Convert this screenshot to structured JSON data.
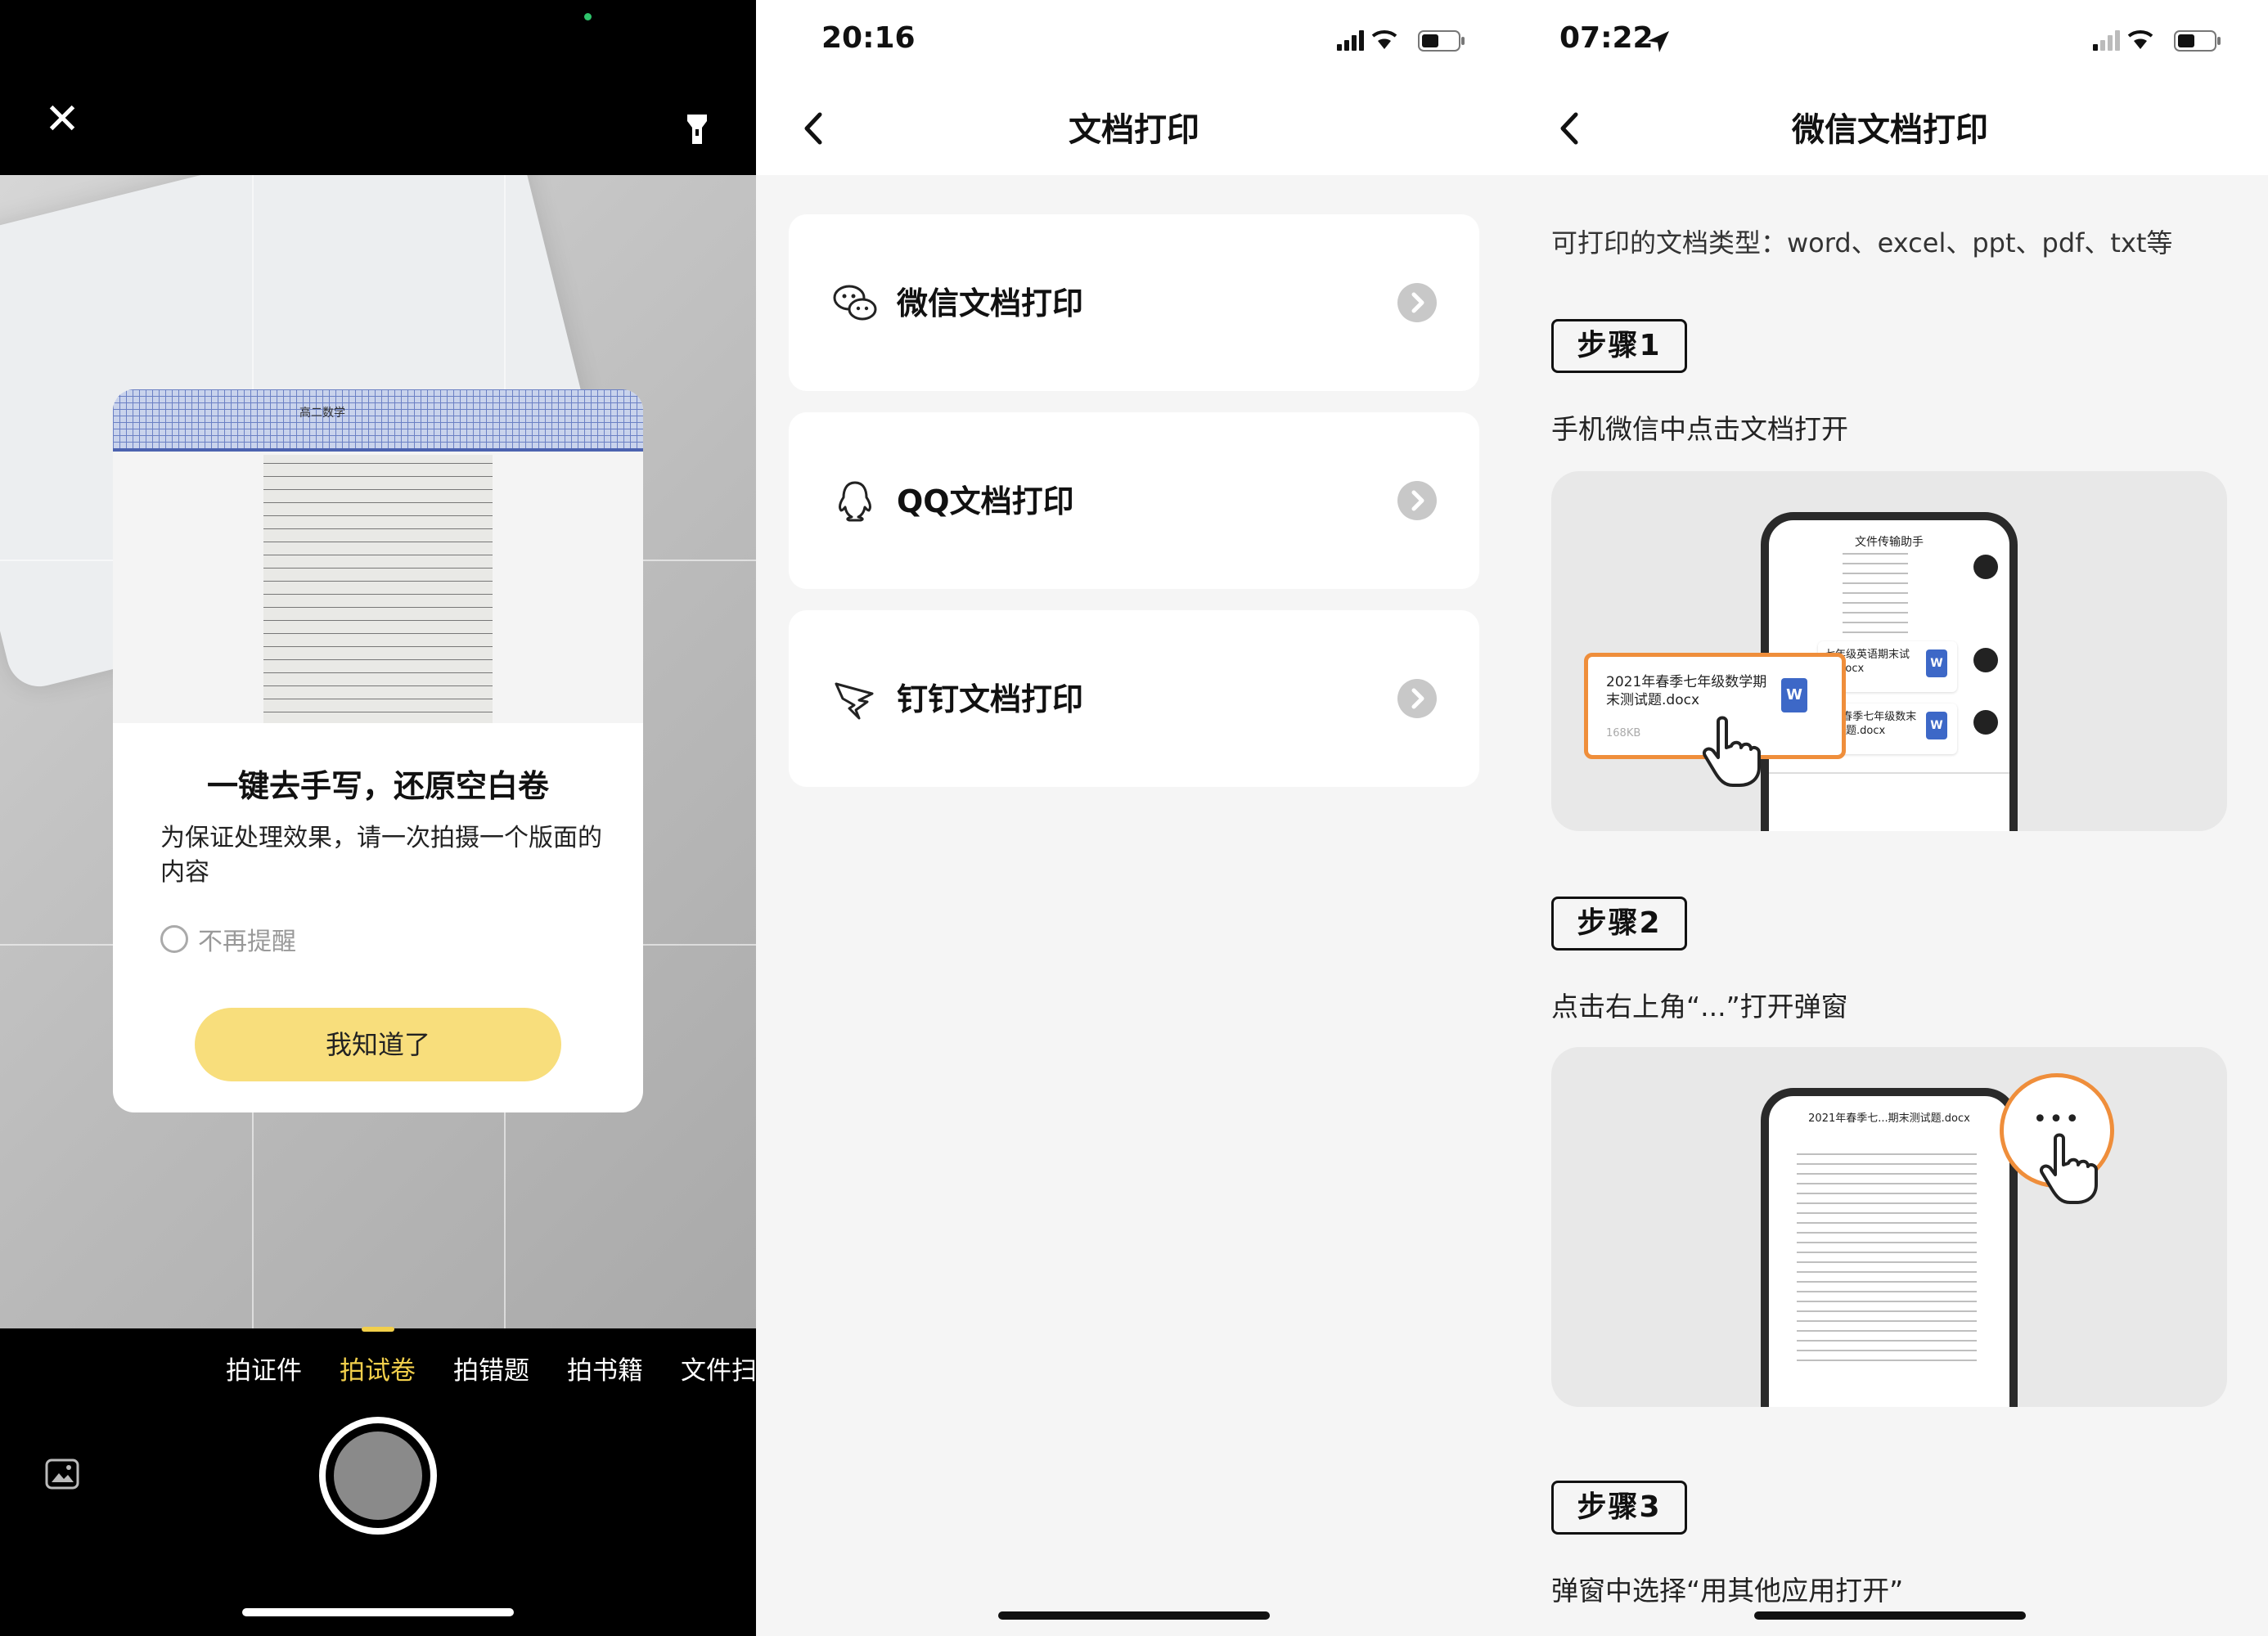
{
  "panel_camera": {
    "dialog": {
      "title": "一键去手写，还原空白卷",
      "body": "为保证处理效果，请一次拍摄一个版面的内容",
      "checkbox_label": "不再提醒",
      "confirm_button": "我知道了",
      "preview_paper_title": "高二数学"
    },
    "modes": [
      {
        "label": "拍证件",
        "active": false
      },
      {
        "label": "拍试卷",
        "active": true
      },
      {
        "label": "拍错题",
        "active": false
      },
      {
        "label": "拍书籍",
        "active": false
      },
      {
        "label": "文件扫",
        "active": false
      }
    ],
    "accent_color": "#f2cf4b",
    "icons": [
      "close-icon",
      "flashlight-icon",
      "gallery-icon",
      "shutter-button"
    ]
  },
  "panel_doc_print": {
    "status_time": "20:16",
    "title": "文档打印",
    "items": [
      {
        "label": "微信文档打印",
        "icon": "wechat-icon"
      },
      {
        "label": "QQ文档打印",
        "icon": "qq-icon"
      },
      {
        "label": "钉钉文档打印",
        "icon": "dingtalk-icon"
      }
    ]
  },
  "panel_wechat_print": {
    "status_time": "07:22",
    "title": "微信文档打印",
    "intro": "可打印的文档类型：word、excel、ppt、pdf、txt等",
    "steps": [
      {
        "badge": "步骤1",
        "desc": "手机微信中点击文档打开"
      },
      {
        "badge": "步骤2",
        "desc": "点击右上角“...”打开弹窗"
      },
      {
        "badge": "步骤3",
        "desc": "弹窗中选择“用其他应用打开”"
      }
    ],
    "illus1": {
      "phone_title": "文件传输助手",
      "highlight_file_name": "2021年春季七年级数学期末测试题.docx",
      "highlight_file_size": "168KB",
      "file_a": "七年级英语期末试题.docx",
      "file_b": "1年春季七年级数末测试题.docx",
      "word_badge": "W"
    },
    "illus2": {
      "phone_title": "2021年春季七...期末测试题.docx",
      "more_dots": "•••"
    },
    "highlight_color": "#ef8e3b"
  }
}
